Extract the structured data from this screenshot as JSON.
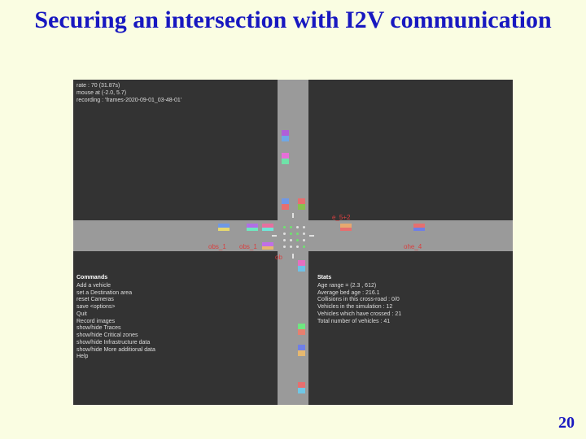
{
  "title": "Securing an intersection with I2V communication",
  "page_number": "20",
  "sim": {
    "info": {
      "line1": "rate : 70 (31.87s)",
      "line2": "mouse at (-2.0, 5.7)",
      "line3": "recording : 'frames-2020-09-01_03-48-01'"
    },
    "obs_labels": [
      "obs_1",
      "obs_1",
      "ob",
      "e_5+2",
      "ohe_4"
    ],
    "commands": {
      "header": "Commands",
      "items": [
        "Add a vehicle",
        "set a Destination area",
        "reset Cameras",
        "save <options>",
        "Quit",
        "Record images",
        "show/hide Traces",
        "show/hide Critical zones",
        "show/hide Infrastructure data",
        "show/hide More additional data",
        "Help"
      ]
    },
    "stats": {
      "header": "Stats",
      "items": [
        "Age range = (2.3 , 612)",
        "Average bed age : 216.1",
        "Collisions in this cross-road : 0/0",
        "Vehicles in the simulation : 12",
        "Vehicles which have crossed : 21",
        "Total number of vehicles : 41"
      ]
    }
  }
}
